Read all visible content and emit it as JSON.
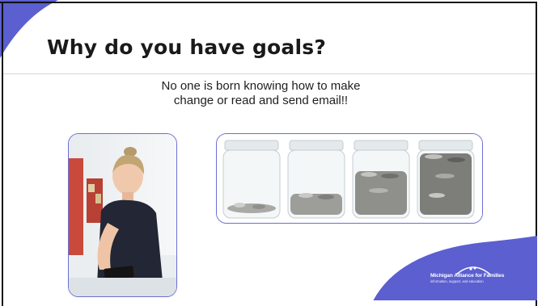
{
  "slide": {
    "title": "Why do you have goals?",
    "subtitle_lines": [
      "No one is born knowing how to make",
      "change or read and send email!!"
    ],
    "images": {
      "left_photo": "girl-using-smartphone-photo",
      "right_photo": "coin-jars-photo"
    },
    "logo": {
      "name": "Michigan Alliance for Families",
      "tagline": "information, support, and education"
    },
    "colors": {
      "accent_purple": "#5b5fd0",
      "frame_border": "#6b6fd4",
      "title_text": "#1a1a1a"
    }
  }
}
